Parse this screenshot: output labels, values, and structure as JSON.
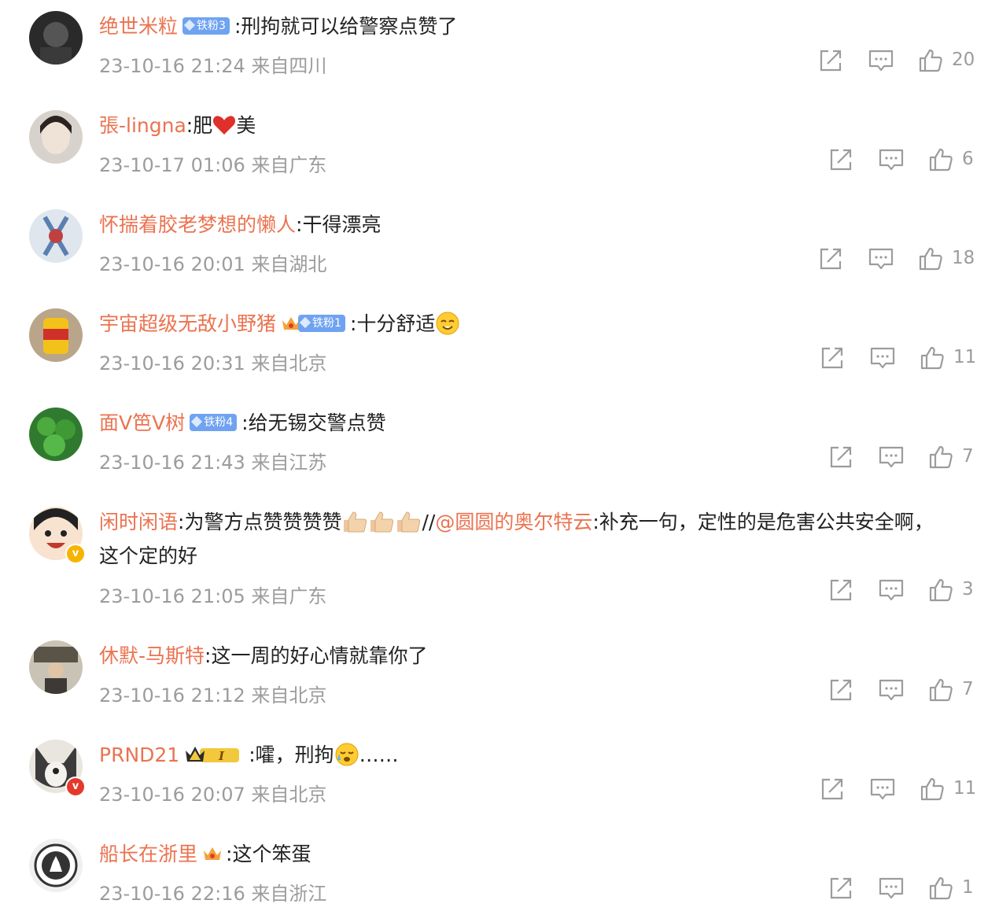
{
  "colors": {
    "username": "#eb7350",
    "text": "#222222",
    "meta": "#9c9c9c",
    "fan_badge": "#6fa3f2"
  },
  "icons": [
    "share-icon",
    "comment-icon",
    "like-icon"
  ],
  "comments": [
    {
      "user": "绝世米粒",
      "badge": "铁粉3",
      "text": ":刑拘就可以给警察点赞了",
      "time": "23-10-16 21:24",
      "loc": "来自四川",
      "likes": "20"
    },
    {
      "user": "張-lingna",
      "text_a": ":肥",
      "text_b": "美",
      "time": "23-10-17 01:06",
      "loc": "来自广东",
      "likes": "6"
    },
    {
      "user": "怀揣着胶老梦想的懒人",
      "text": ":干得漂亮",
      "time": "23-10-16 20:01",
      "loc": "来自湖北",
      "likes": "18"
    },
    {
      "user": "宇宙超级无敌小野猪",
      "badge": "铁粉1",
      "text": ":十分舒适",
      "time": "23-10-16 20:31",
      "loc": "来自北京",
      "likes": "11"
    },
    {
      "user": "面V笆V树",
      "badge": "铁粉4",
      "text": ":给无锡交警点赞",
      "time": "23-10-16 21:43",
      "loc": "来自江苏",
      "likes": "7"
    },
    {
      "user": "闲时闲语",
      "text_a": ":为警方点赞赞赞赞",
      "sep": "//",
      "mention": "@圆圆的奥尔特云",
      "text_b": ":补充一句，定性的是危害公共安全啊，",
      "text_c": "这个定的好",
      "time": "23-10-16 21:05",
      "loc": "来自广东",
      "likes": "3"
    },
    {
      "user": "休默-马斯特",
      "text": ":这一周的好心情就靠你了",
      "time": "23-10-16 21:12",
      "loc": "来自北京",
      "likes": "7"
    },
    {
      "user": "PRND21",
      "text_a": ":嚯，刑拘",
      "text_b": "……",
      "time": "23-10-16 20:07",
      "loc": "来自北京",
      "likes": "11"
    },
    {
      "user": "船长在浙里",
      "text": ":这个笨蛋",
      "time": "23-10-16 22:16",
      "loc": "来自浙江",
      "likes": "1"
    }
  ]
}
